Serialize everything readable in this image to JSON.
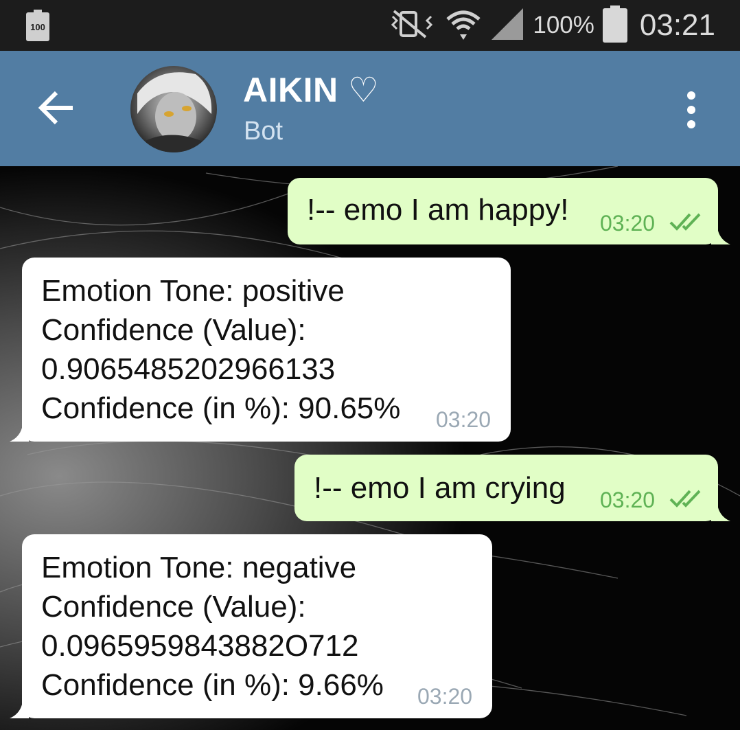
{
  "status_bar": {
    "left_battery_label": "100",
    "battery_percent": "100%",
    "time": "03:21",
    "icons": [
      "battery-small-icon",
      "mute-vibrate-icon",
      "wifi-icon",
      "signal-icon",
      "battery-icon"
    ]
  },
  "header": {
    "back_icon": "arrow-left-icon",
    "title": "AIKIN ♡",
    "subtitle": "Bot",
    "menu_icon": "more-vertical-icon"
  },
  "messages": [
    {
      "direction": "outgoing",
      "text": "!-- emo I am happy!",
      "time": "03:20",
      "status_icon": "double-check-icon"
    },
    {
      "direction": "incoming",
      "lines": [
        "Emotion Tone: positive",
        "Confidence (Value):",
        "0.9065485202966133",
        "Confidence (in %): 90.65%"
      ],
      "time": "03:20"
    },
    {
      "direction": "outgoing",
      "text": "!-- emo I am crying",
      "time": "03:20",
      "status_icon": "double-check-icon"
    },
    {
      "direction": "incoming",
      "lines": [
        "Emotion Tone: negative",
        "Confidence (Value):",
        "0.0965959843882O712",
        "Confidence (in %): 9.66%"
      ],
      "time": "03:20"
    }
  ],
  "colors": {
    "header": "#527da3",
    "outgoing_bubble": "#e1fec6",
    "incoming_bubble": "#ffffff",
    "outgoing_time": "#5fb255",
    "incoming_time": "#9aa8b4"
  }
}
